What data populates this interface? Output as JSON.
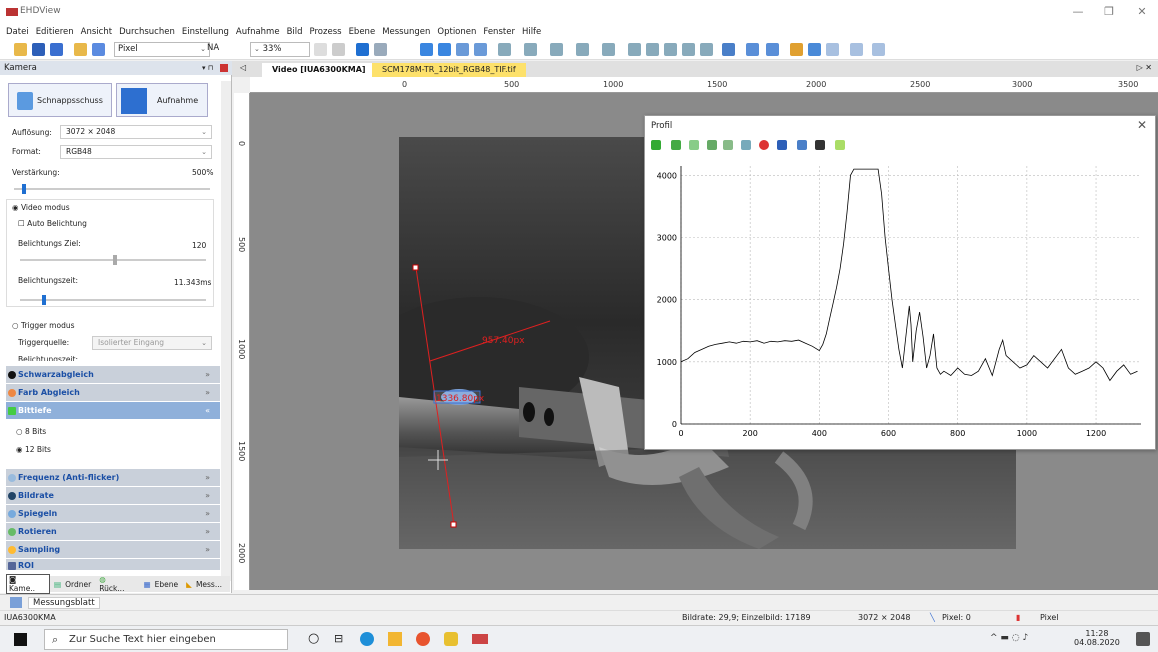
{
  "window": {
    "title": "EHDView",
    "minimize": "—",
    "maximize": "❐",
    "close": "✕"
  },
  "menu": [
    "Datei",
    "Editieren",
    "Ansicht",
    "Durchsuchen",
    "Einstellung",
    "Aufnahme",
    "Bild",
    "Prozess",
    "Ebene",
    "Messungen",
    "Optionen",
    "Fenster",
    "Hilfe"
  ],
  "toolbar": {
    "unit": "Pixel",
    "na": "NA",
    "zoom": "33%"
  },
  "panel": {
    "title": "Kamera",
    "snapshot": "Schnappsschuss",
    "record": "Aufnahme",
    "resolution_label": "Auflösung:",
    "resolution": "3072 × 2048",
    "format_label": "Format:",
    "format": "RGB48",
    "gain_label": "Verstärkung:",
    "gain": "500%",
    "gain_pct": 4,
    "video_mode": "Video modus",
    "auto_exposure": "Auto Belichtung",
    "exposure_target_label": "Belichtungs Ziel:",
    "exposure_target": "120",
    "exposure_target_pct": 50,
    "exposure_time_label": "Belichtungszeit:",
    "exposure_time": "11.343ms",
    "exposure_time_pct": 12,
    "trigger_mode": "Trigger modus",
    "trigger_source_label": "Triggerquelle:",
    "trigger_source": "Isolierter Eingang",
    "exposure_time_cut": "Belichtungszeit:",
    "sections": {
      "black": "Schwarzabgleich",
      "color": "Farb Abgleich",
      "bitdepth": "Bittiefe",
      "bits8": "8 Bits",
      "bits12": "12 Bits",
      "freq": "Frequenz (Anti-flicker)",
      "framerate": "Bildrate",
      "mirror": "Spiegeln",
      "rotate": "Rotieren",
      "sampling": "Sampling",
      "roi": "ROI"
    },
    "bottom_tabs": [
      "Kame..",
      "Ordner",
      "Rück...",
      "Ebene",
      "Mess..."
    ]
  },
  "tabs": {
    "video": "Video [IUA6300KMA]",
    "file": "SCM178M-TR_12bit_RGB48_TIF.tif"
  },
  "ruler_top": [
    "0",
    "500",
    "1000",
    "1500",
    "2000",
    "2500",
    "3000",
    "3500"
  ],
  "ruler_left": [
    "0",
    "500",
    "1000",
    "1500",
    "2000"
  ],
  "measurements": {
    "line1": "957.40px",
    "line2": "1336.80px"
  },
  "profile": {
    "title": "Profil",
    "close": "✕",
    "chart_data": {
      "type": "line",
      "x_ticks": [
        0,
        200,
        400,
        600,
        800,
        1000,
        1200
      ],
      "y_ticks": [
        0,
        1000,
        2000,
        3000,
        4000
      ],
      "xlim": [
        0,
        1330
      ],
      "ylim": [
        0,
        4150
      ],
      "grid": true,
      "series": [
        {
          "x": [
            0,
            20,
            40,
            60,
            80,
            100,
            120,
            140,
            160,
            180,
            200,
            220,
            240,
            260,
            280,
            300,
            320,
            340,
            360,
            380,
            400,
            410,
            420,
            430,
            440,
            450,
            460,
            470,
            480,
            490,
            500,
            520,
            540,
            560,
            570,
            580,
            590,
            600,
            610,
            620,
            630,
            640,
            650,
            660,
            665,
            670,
            680,
            690,
            700,
            710,
            720,
            730,
            740,
            750,
            760,
            780,
            800,
            820,
            840,
            860,
            880,
            900,
            920,
            930,
            940,
            960,
            980,
            1000,
            1020,
            1040,
            1060,
            1080,
            1100,
            1120,
            1140,
            1160,
            1180,
            1200,
            1220,
            1240,
            1260,
            1280,
            1300,
            1320
          ],
          "y": [
            1000,
            1050,
            1150,
            1200,
            1250,
            1280,
            1300,
            1320,
            1300,
            1330,
            1320,
            1340,
            1300,
            1330,
            1320,
            1340,
            1330,
            1350,
            1300,
            1250,
            1180,
            1280,
            1450,
            1700,
            1950,
            2200,
            2500,
            2900,
            3400,
            4000,
            4100,
            4100,
            4100,
            4100,
            4100,
            3700,
            3000,
            2500,
            2000,
            1600,
            1200,
            900,
            1400,
            1900,
            1600,
            1000,
            1500,
            1800,
            1400,
            900,
            1100,
            1450,
            900,
            800,
            850,
            780,
            900,
            800,
            780,
            850,
            1050,
            780,
            1200,
            1350,
            1100,
            1000,
            900,
            950,
            1100,
            1000,
            900,
            1050,
            1200,
            900,
            800,
            850,
            900,
            1000,
            900,
            700,
            850,
            950,
            800,
            850
          ]
        }
      ]
    }
  },
  "sheet": "Messungsblatt",
  "status": {
    "camera": "IUA6300KMA",
    "framerate": "Bildrate: 29,9; Einzelbild: 17189",
    "size": "3072 × 2048",
    "pixel_value": "Pixel: 0",
    "pixel_unit": "Pixel"
  },
  "taskbar": {
    "search": "Zur Suche Text hier eingeben",
    "time": "11:28",
    "date": "04.08.2020"
  }
}
